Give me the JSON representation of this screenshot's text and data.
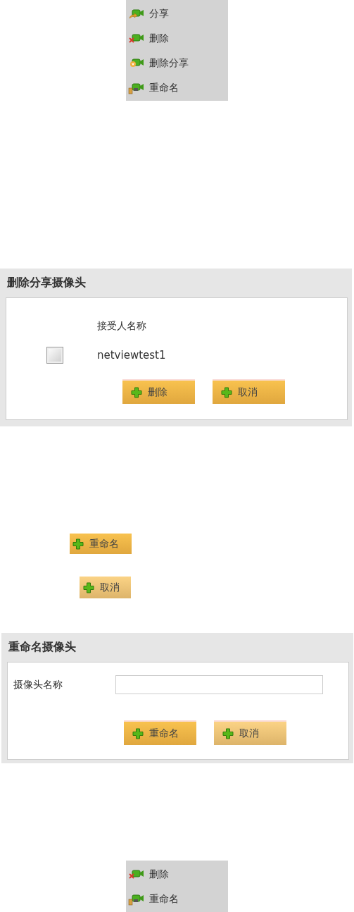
{
  "menu_top": {
    "items": [
      {
        "kind": "share",
        "label": "分享"
      },
      {
        "kind": "delete",
        "label": "删除"
      },
      {
        "kind": "unshare",
        "label": "删除分享"
      },
      {
        "kind": "rename",
        "label": "重命名"
      }
    ]
  },
  "unshare_dialog": {
    "title": "删除分享摄像头",
    "column_header": "接受人名称",
    "rows": [
      {
        "name": "netviewtest1",
        "checked": false
      }
    ],
    "buttons": [
      {
        "label": "删除",
        "pale": false
      },
      {
        "label": "取消",
        "pale": false
      }
    ]
  },
  "loose_buttons": [
    {
      "label": "重命名",
      "pale": false
    },
    {
      "label": "取消",
      "pale": true
    }
  ],
  "rename_dialog": {
    "title": "重命名摄像头",
    "field_label": "摄像头名称",
    "buttons": [
      {
        "label": "重命名",
        "pale": false
      },
      {
        "label": "取消",
        "pale": true
      }
    ]
  },
  "menu_bottom": {
    "items": [
      {
        "kind": "delete",
        "label": "删除"
      },
      {
        "kind": "rename",
        "label": "重命名"
      }
    ]
  }
}
